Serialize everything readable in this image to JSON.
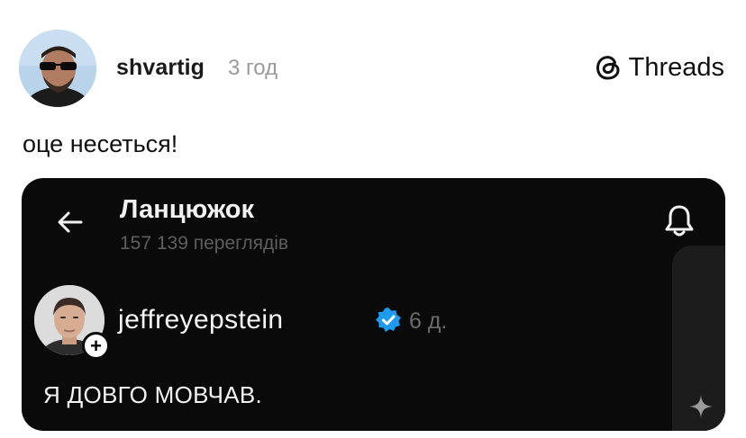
{
  "post": {
    "username": "shvartig",
    "timestamp": "3 год",
    "text": "оце несеться!"
  },
  "brand": {
    "label": "Threads",
    "icon": "threads-logo-icon"
  },
  "embedded_screenshot": {
    "title": "Ланцюжок",
    "views": "157 139 переглядів",
    "author": {
      "username": "jeffreyepstein",
      "verified": true,
      "age": "6 д."
    },
    "post_text": "Я ДОВГО МОВЧАВ.",
    "icons": [
      "back-arrow-icon",
      "bell-icon",
      "verified-badge-icon",
      "plus-icon",
      "sparkle-icon"
    ]
  },
  "colors": {
    "card_background": "#0a0a0a",
    "verified_blue": "#1d9bf0",
    "muted_text": "#9a9a9a"
  }
}
